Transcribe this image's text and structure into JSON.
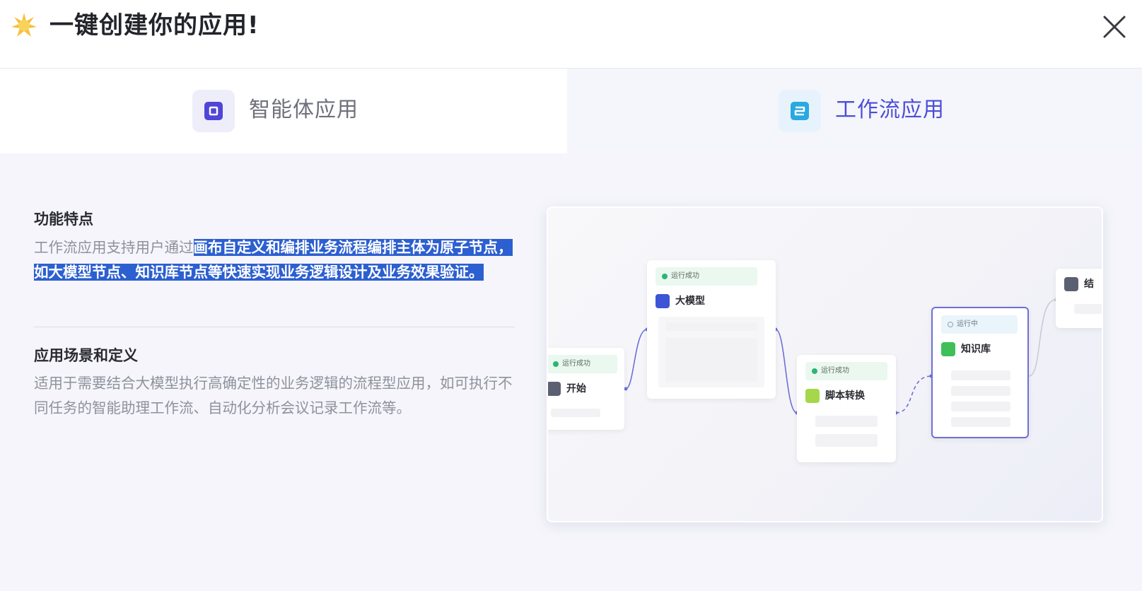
{
  "header": {
    "title": "一键创建你的应用!",
    "logo_icon": "sparkle-icon",
    "close_icon": "close-icon"
  },
  "tabs": [
    {
      "label": "智能体应用",
      "icon": "agent-app-icon",
      "active": false
    },
    {
      "label": "工作流应用",
      "icon": "workflow-app-icon",
      "active": true
    }
  ],
  "features": {
    "title": "功能特点",
    "text_plain": "工作流应用支持用户通过",
    "text_selected": "画布自定义和编排业务流程编排主体为原子节点，如大模型节点、知识库节点等快速实现业务逻辑设计及业务效果验证。"
  },
  "scenarios": {
    "title": "应用场景和定义",
    "text": "适用于需要结合大模型执行高确定性的业务逻辑的流程型应用，如可执行不同任务的智能助理工作流、自动化分析会议记录工作流等。"
  },
  "preview": {
    "nodes": [
      {
        "key": "start",
        "status": "运行成功",
        "label": "开始",
        "icon": "start-icon"
      },
      {
        "key": "llm",
        "status": "运行成功",
        "label": "大模型",
        "icon": "llm-icon"
      },
      {
        "key": "script",
        "status": "运行成功",
        "label": "脚本转换",
        "icon": "script-icon"
      },
      {
        "key": "kb",
        "status": "运行中",
        "label": "知识库",
        "icon": "knowledge-base-icon"
      },
      {
        "key": "end",
        "label": "结",
        "icon": "end-icon"
      }
    ],
    "colors": {
      "accent": "#4a4fd6",
      "edge": "#6e6fd6",
      "success": "#2bb673",
      "selection": "#2c5fd0"
    }
  }
}
